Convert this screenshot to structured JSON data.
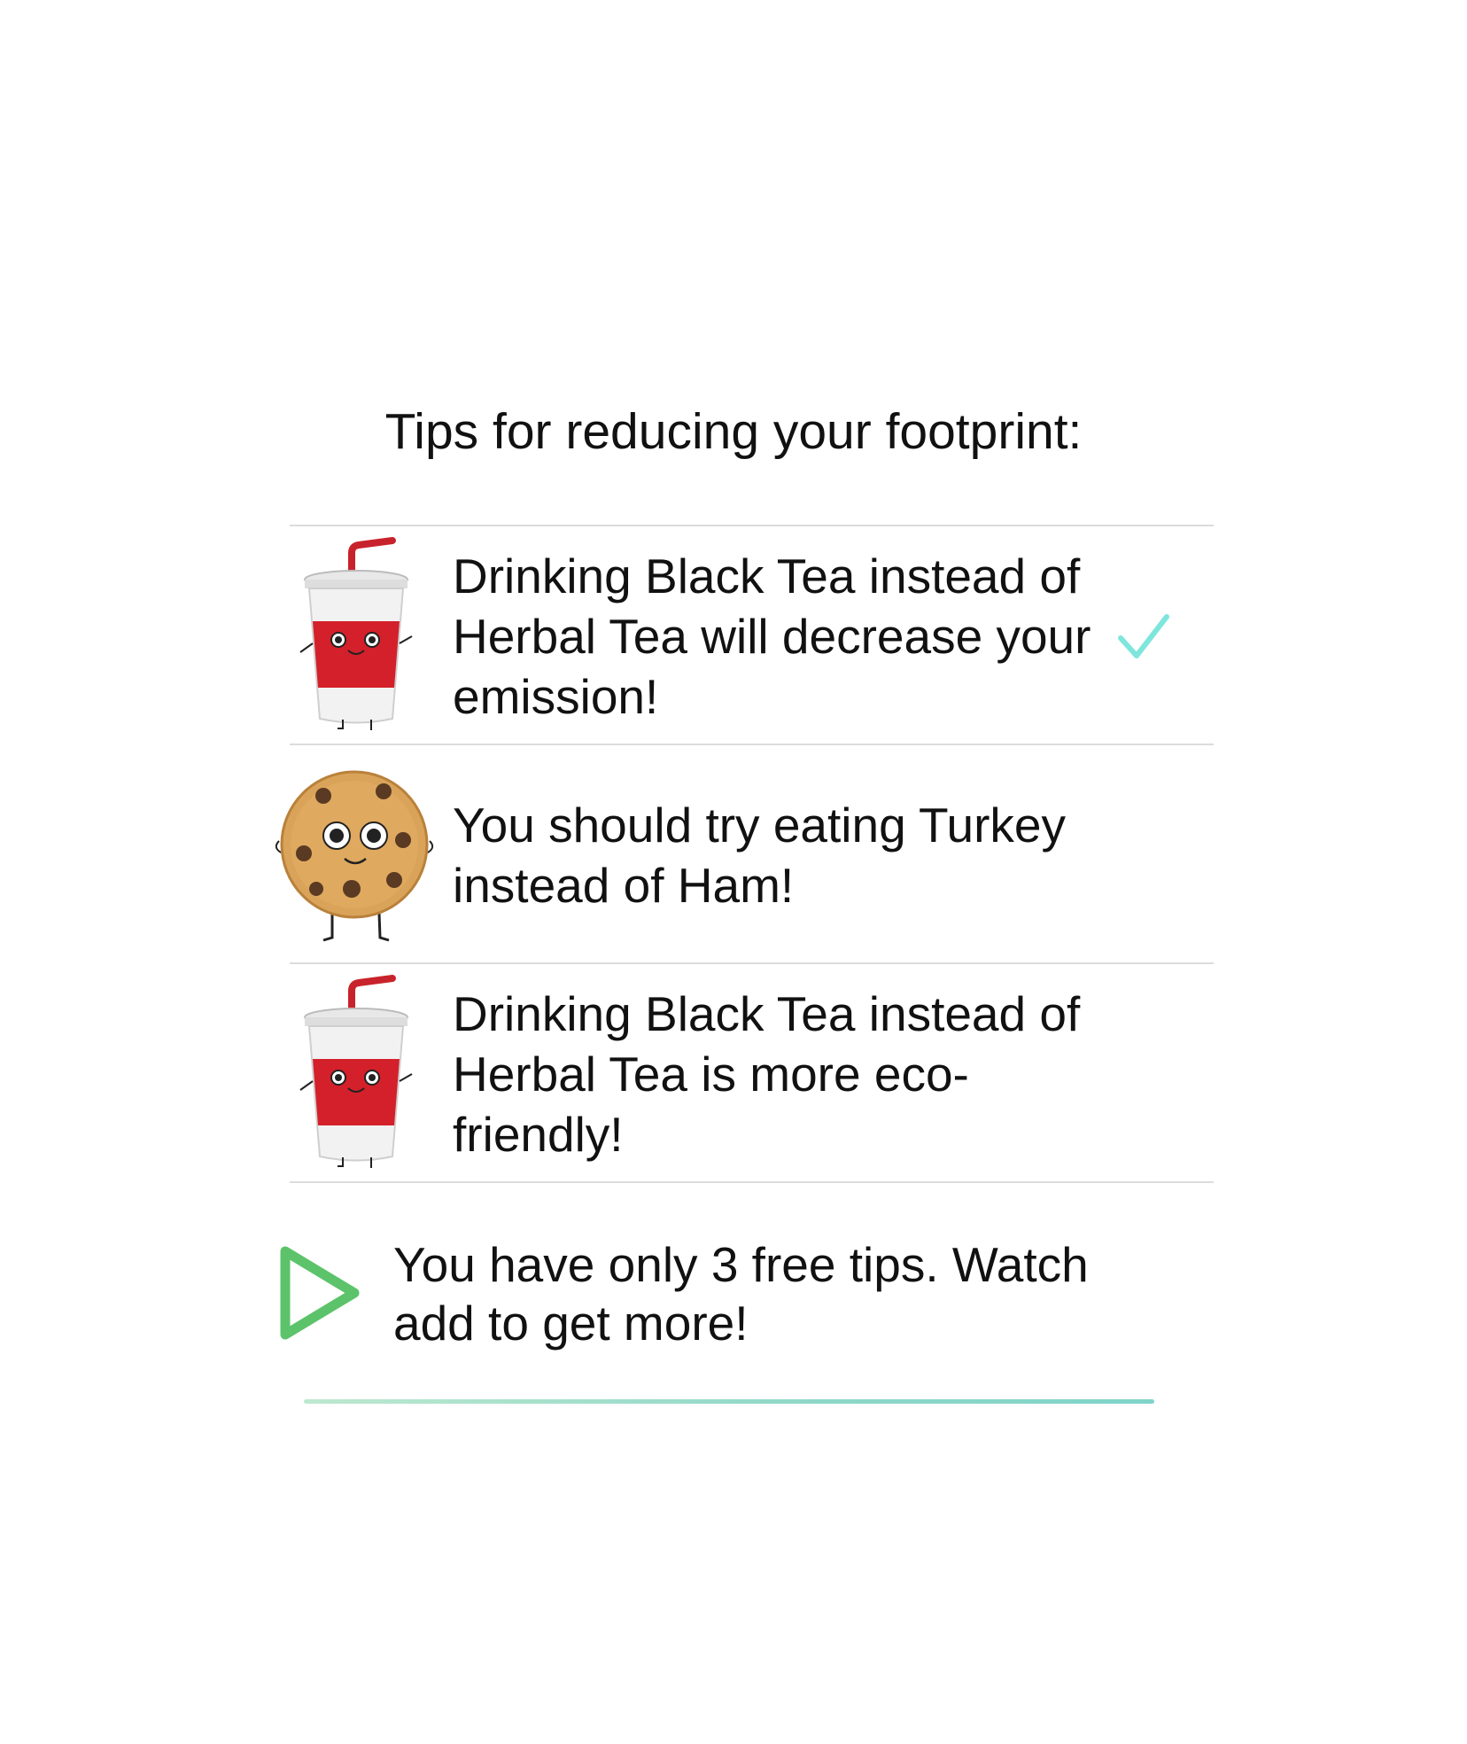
{
  "header": {
    "title": "Tips for reducing your footprint:"
  },
  "tips": [
    {
      "icon": "soda-cup-mascot-icon",
      "text": "Drinking Black Tea instead of Herbal Tea will decrease your emission!",
      "selected": true
    },
    {
      "icon": "cookie-mascot-icon",
      "text": "You should try eating Turkey instead of Ham!",
      "selected": false
    },
    {
      "icon": "soda-cup-mascot-icon",
      "text": "Drinking Black Tea instead of Herbal Tea is more eco-friendly!",
      "selected": false
    }
  ],
  "free_tips": {
    "icon": "play-icon",
    "text": "You have only 3 free tips. Watch add to get more!"
  },
  "colors": {
    "checkmark": "#7ee6dc",
    "play_icon": "#5cc36a",
    "divider": "#dcdcdc",
    "accent_line": "#8ed7c8"
  }
}
